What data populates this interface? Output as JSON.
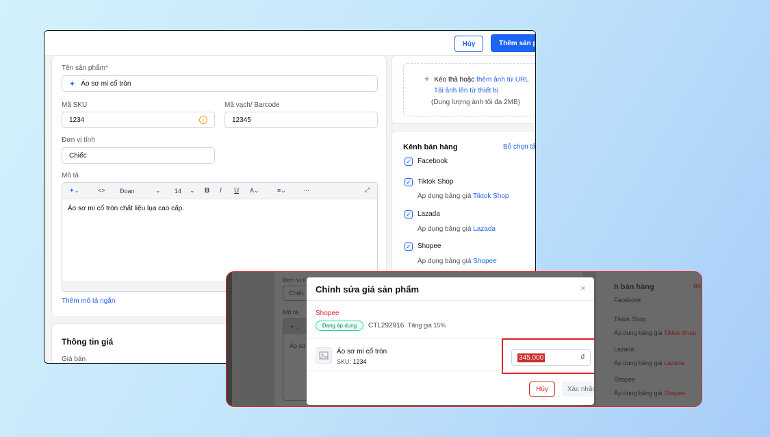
{
  "header": {
    "cancel_label": "Hủy",
    "add_label": "Thêm sản p"
  },
  "product": {
    "name_label": "Tên sản phẩm",
    "name_required": "*",
    "name_value": "Áo sơ mi cổ tròn",
    "sku_label": "Mã SKU",
    "sku_value": "1234",
    "barcode_label": "Mã vạch/ Barcode",
    "barcode_value": "12345",
    "unit_label": "Đơn vị tính",
    "unit_value": "Chiếc",
    "desc_label": "Mô tả",
    "desc_value": "Áo sơ mi cổ tròn chất liệu lụa cao cấp.",
    "short_desc_link": "Thêm mô tả ngắn"
  },
  "editor": {
    "paragraph": "Đoạn",
    "font_size": "14",
    "bold": "B",
    "italic": "I",
    "underline": "U",
    "more": "···"
  },
  "price_section": {
    "title": "Thông tin giá",
    "sale_price_label": "Giá bán"
  },
  "upload": {
    "drag_text": "Kéo thả hoặc",
    "url_link": "thêm ảnh từ URL",
    "device_link": "Tải ảnh lên từ thiết bị",
    "limit_text": "(Dung lượng ảnh tối đa 2MB)"
  },
  "channels": {
    "title": "Kênh bán hàng",
    "deselect_all": "Bỏ chọn tấ",
    "apply_prefix": "Áp dụng bảng giá",
    "items": [
      {
        "name": "Facebook"
      },
      {
        "name": "Tiktok Shop",
        "price_list": "Tiktok Shop"
      },
      {
        "name": "Lazada",
        "price_list": "Lazada"
      },
      {
        "name": "Shopee",
        "price_list": "Shopee"
      }
    ]
  },
  "zoom_bg": {
    "unit_label": "Đơn vị tí",
    "unit_value": "Chiếc",
    "desc_label": "Mô tả",
    "desc_value": "Áo sơ",
    "channels_title": "h bán hàng",
    "channels_right": "Bỏ",
    "facebook": "Facebook",
    "tiktok": "Tiktok Shop",
    "apply_tiktok_prefix": "Áp dụng bảng giá",
    "apply_tiktok_link": "Tiktok Shop",
    "lazada": "Lazada",
    "apply_lazada_prefix": "Áp dụng bảng giá",
    "apply_lazada_link": "Lazada",
    "shopee": "Shopee",
    "apply_shopee_prefix": "Áp dụng bảng giá",
    "apply_shopee_link": "Shopee"
  },
  "modal": {
    "title": "Chỉnh sửa giá sản phẩm",
    "channel": "Shopee",
    "status_badge": "Đang áp dụng",
    "price_list_code": "CTL292916",
    "price_rule": "Tăng giá 15%",
    "product_name": "Áo sơ mi cổ tròn",
    "sku_prefix": "SKU:",
    "sku": "1234",
    "price_value": "345,000",
    "currency": "đ",
    "cancel_label": "Hủy",
    "confirm_label": "Xác nhận"
  },
  "colors": {
    "primary": "#1d64f2",
    "danger": "#dc2626",
    "success": "#059669"
  }
}
